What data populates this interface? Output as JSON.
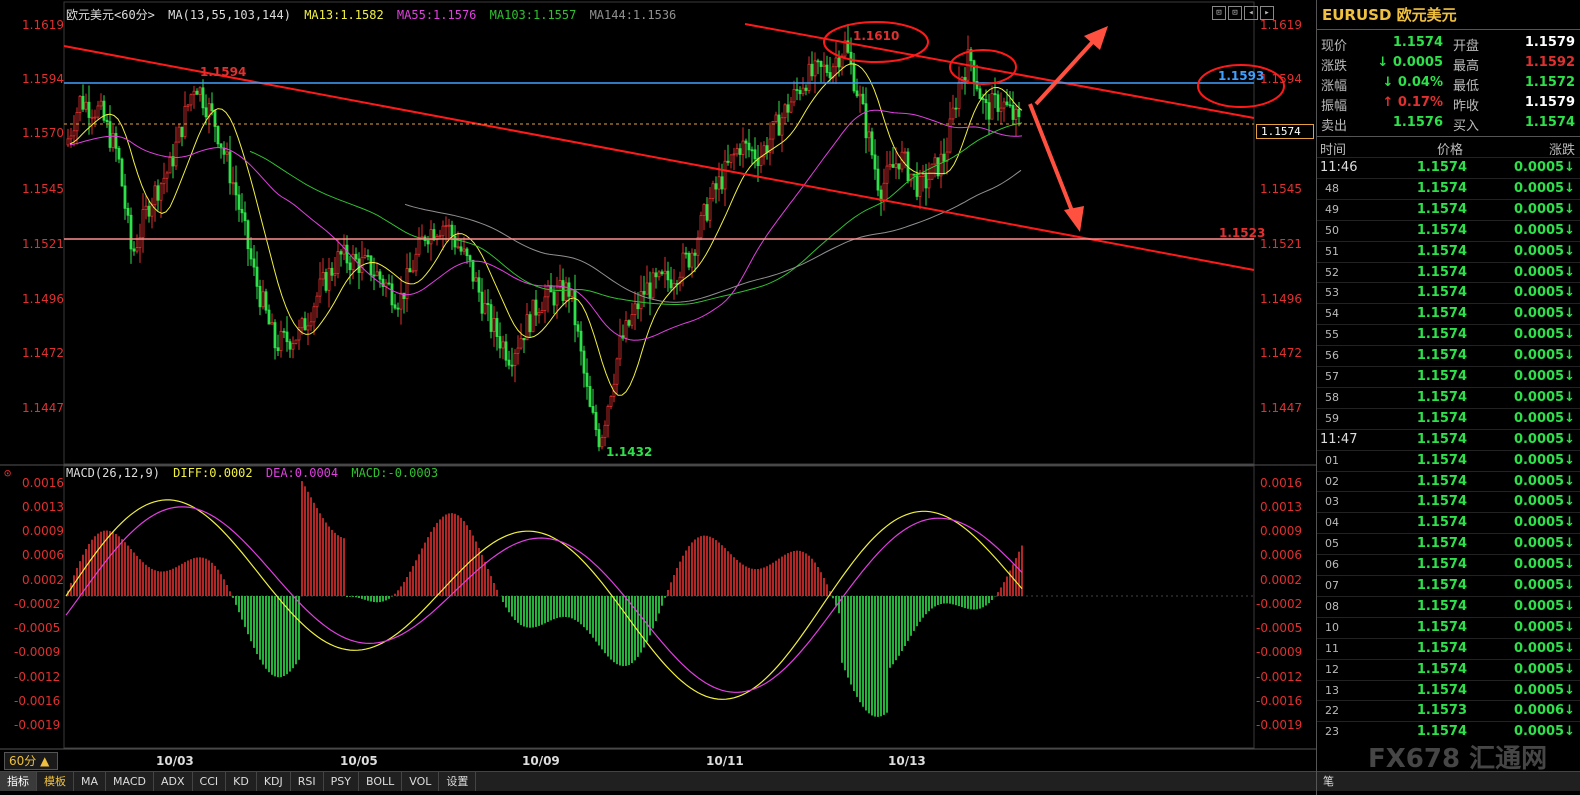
{
  "colors": {
    "up": "#e03030",
    "down": "#2ee04a",
    "ma13": "#f0f040",
    "ma55": "#e040e0",
    "ma103": "#30c030",
    "ma144": "#909090",
    "trend": "#ff1a1a",
    "support": "#ff9090",
    "resistance": "#40a0ff"
  },
  "main_legend": {
    "title": "欧元美元<60分>",
    "ma_params": "MA(13,55,103,144)",
    "ma13": "MA13:1.1582",
    "ma55": "MA55:1.1576",
    "ma103": "MA103:1.1557",
    "ma144": "MA144:1.1536"
  },
  "window_buttons": [
    "⊡",
    "⊡",
    "◂",
    "▸"
  ],
  "y_axis_price": [
    "1.1619",
    "1.1594",
    "1.1570",
    "1.1545",
    "1.1521",
    "1.1496",
    "1.1472",
    "1.1447"
  ],
  "y_axis_price_right": [
    "1.1619",
    "1.1594",
    "1.1570",
    "1.1545",
    "1.1521",
    "1.1496",
    "1.1472",
    "1.1447"
  ],
  "x_axis_dates": [
    "10/03",
    "10/05",
    "10/09",
    "10/11",
    "10/13"
  ],
  "annotations": {
    "high_1594": "1.1594",
    "high_1610": "1.1610",
    "level_1593": "1.1593",
    "level_1523": "1.1523",
    "low_1432": "1.1432",
    "current_price": "1.1574"
  },
  "macd_legend": {
    "params": "MACD(26,12,9)",
    "diff": "DIFF:0.0002",
    "dea": "DEA:0.0004",
    "macd": "MACD:-0.0003"
  },
  "y_axis_macd": [
    "0.0016",
    "0.0013",
    "0.0009",
    "0.0006",
    "0.0002",
    "-0.0002",
    "-0.0005",
    "-0.0009",
    "-0.0012",
    "-0.0016",
    "-0.0019"
  ],
  "period_button": "60分 ▲",
  "toolbar": [
    "指标",
    "模板",
    "MA",
    "MACD",
    "ADX",
    "CCI",
    "KD",
    "KDJ",
    "RSI",
    "PSY",
    "BOLL",
    "VOL",
    "设置"
  ],
  "side": {
    "title": "EURUSD 欧元美元",
    "quotes": [
      {
        "l1": "现价",
        "v1": "1.1574",
        "c1": "#2ee04a",
        "l2": "开盘",
        "v2": "1.1579",
        "c2": "#ffffff"
      },
      {
        "l1": "涨跌",
        "v1": "↓ 0.0005",
        "c1": "#2ee04a",
        "l2": "最高",
        "v2": "1.1592",
        "c2": "#e03030"
      },
      {
        "l1": "涨幅",
        "v1": "↓ 0.04%",
        "c1": "#2ee04a",
        "l2": "最低",
        "v2": "1.1572",
        "c2": "#2ee04a"
      },
      {
        "l1": "振幅",
        "v1": "↑ 0.17%",
        "c1": "#e03030",
        "l2": "昨收",
        "v2": "1.1579",
        "c2": "#ffffff"
      },
      {
        "l1": "卖出",
        "v1": "1.1576",
        "c1": "#2ee04a",
        "l2": "买入",
        "v2": "1.1574",
        "c2": "#2ee04a"
      }
    ],
    "tick_headers": [
      "时间",
      "价格",
      "涨跌"
    ],
    "ticks": [
      {
        "t": "11:46",
        "p": "1.1574",
        "c": "0.0005↓"
      },
      {
        "t": "48",
        "p": "1.1574",
        "c": "0.0005↓"
      },
      {
        "t": "49",
        "p": "1.1574",
        "c": "0.0005↓"
      },
      {
        "t": "50",
        "p": "1.1574",
        "c": "0.0005↓"
      },
      {
        "t": "51",
        "p": "1.1574",
        "c": "0.0005↓"
      },
      {
        "t": "52",
        "p": "1.1574",
        "c": "0.0005↓"
      },
      {
        "t": "53",
        "p": "1.1574",
        "c": "0.0005↓"
      },
      {
        "t": "54",
        "p": "1.1574",
        "c": "0.0005↓"
      },
      {
        "t": "55",
        "p": "1.1574",
        "c": "0.0005↓"
      },
      {
        "t": "56",
        "p": "1.1574",
        "c": "0.0005↓"
      },
      {
        "t": "57",
        "p": "1.1574",
        "c": "0.0005↓"
      },
      {
        "t": "58",
        "p": "1.1574",
        "c": "0.0005↓"
      },
      {
        "t": "59",
        "p": "1.1574",
        "c": "0.0005↓"
      },
      {
        "t": "11:47",
        "p": "1.1574",
        "c": "0.0005↓"
      },
      {
        "t": "01",
        "p": "1.1574",
        "c": "0.0005↓"
      },
      {
        "t": "02",
        "p": "1.1574",
        "c": "0.0005↓"
      },
      {
        "t": "03",
        "p": "1.1574",
        "c": "0.0005↓"
      },
      {
        "t": "04",
        "p": "1.1574",
        "c": "0.0005↓"
      },
      {
        "t": "05",
        "p": "1.1574",
        "c": "0.0005↓"
      },
      {
        "t": "06",
        "p": "1.1574",
        "c": "0.0005↓"
      },
      {
        "t": "07",
        "p": "1.1574",
        "c": "0.0005↓"
      },
      {
        "t": "08",
        "p": "1.1574",
        "c": "0.0005↓"
      },
      {
        "t": "10",
        "p": "1.1574",
        "c": "0.0005↓"
      },
      {
        "t": "11",
        "p": "1.1574",
        "c": "0.0005↓"
      },
      {
        "t": "12",
        "p": "1.1574",
        "c": "0.0005↓"
      },
      {
        "t": "13",
        "p": "1.1574",
        "c": "0.0005↓"
      },
      {
        "t": "22",
        "p": "1.1573",
        "c": "0.0006↓"
      },
      {
        "t": "23",
        "p": "1.1574",
        "c": "0.0005↓"
      }
    ],
    "pen": "笔"
  },
  "watermark": "FX678 汇通网"
}
